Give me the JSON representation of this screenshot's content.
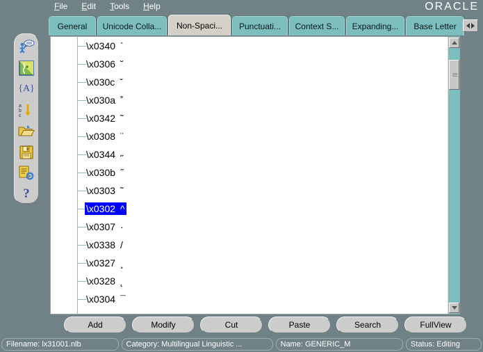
{
  "app": {
    "brand": "ORACLE"
  },
  "menubar": {
    "items": [
      {
        "label": "File",
        "mnemonic": "F"
      },
      {
        "label": "Edit",
        "mnemonic": "E"
      },
      {
        "label": "Tools",
        "mnemonic": "T"
      },
      {
        "label": "Help",
        "mnemonic": "H"
      }
    ]
  },
  "tabs": {
    "items": [
      {
        "label": "General",
        "active": false
      },
      {
        "label": "Unicode Colla...",
        "active": false
      },
      {
        "label": "Non-Spaci...",
        "active": true
      },
      {
        "label": "Punctuati...",
        "active": false
      },
      {
        "label": "Context S...",
        "active": false
      },
      {
        "label": "Expanding...",
        "active": false
      },
      {
        "label": "Base Letter",
        "active": false
      }
    ],
    "scroll_left_icon": "triangle-left-icon",
    "scroll_right_icon": "triangle-right-icon"
  },
  "left_toolbar": {
    "items": [
      {
        "icon": "user-speech-bubble-icon",
        "name": "tool-user-speech"
      },
      {
        "icon": "map-region-icon",
        "name": "tool-map"
      },
      {
        "icon": "braced-a-icon",
        "name": "tool-abc-braces",
        "text": "{A}"
      },
      {
        "icon": "abc-sort-icon",
        "name": "tool-sort"
      },
      {
        "icon": "open-folder-icon",
        "name": "tool-open"
      },
      {
        "icon": "floppy-save-icon",
        "name": "tool-save"
      },
      {
        "icon": "document-gear-icon",
        "name": "tool-document-settings"
      },
      {
        "icon": "question-mark-icon",
        "name": "tool-help",
        "text": "?"
      }
    ]
  },
  "list": {
    "rows": [
      {
        "code": "\\x0340",
        "mark": "`",
        "selected": false
      },
      {
        "code": "\\x0306",
        "mark": "˘",
        "selected": false
      },
      {
        "code": "\\x030c",
        "mark": "ˇ",
        "selected": false
      },
      {
        "code": "\\x030a",
        "mark": "˚",
        "selected": false
      },
      {
        "code": "\\x0342",
        "mark": "˜",
        "selected": false
      },
      {
        "code": "\\x0308",
        "mark": "¨",
        "selected": false
      },
      {
        "code": "\\x0344",
        "mark": "˶",
        "selected": false
      },
      {
        "code": "\\x030b",
        "mark": "˝",
        "selected": false
      },
      {
        "code": "\\x0303",
        "mark": "˜",
        "selected": false
      },
      {
        "code": "\\x0302",
        "mark": "^",
        "selected": true
      },
      {
        "code": "\\x0307",
        "mark": "·",
        "selected": false
      },
      {
        "code": "\\x0338",
        "mark": "/",
        "selected": false
      },
      {
        "code": "\\x0327",
        "mark": "¸",
        "selected": false
      },
      {
        "code": "\\x0328",
        "mark": "˛",
        "selected": false
      },
      {
        "code": "\\x0304",
        "mark": "¯",
        "selected": false
      }
    ]
  },
  "scrollbar": {
    "up_icon": "triangle-up-icon",
    "down_icon": "triangle-down-icon"
  },
  "buttons": [
    {
      "label": "Add"
    },
    {
      "label": "Modify"
    },
    {
      "label": "Cut"
    },
    {
      "label": "Paste"
    },
    {
      "label": "Search"
    },
    {
      "label": "FullView"
    }
  ],
  "statusbar": {
    "filename": "Filename: lx31001.nlb",
    "category": "Category: Multilingual Linguistic ...",
    "name": "Name: GENERIC_M",
    "status": "Status: Editing"
  },
  "colors": {
    "background": "#708285",
    "tab": "#7cbdbd",
    "tab_active": "#d4d0c8",
    "selection": "#0000ff",
    "panel": "#ffffff",
    "tree_line": "#8fc0c0"
  }
}
